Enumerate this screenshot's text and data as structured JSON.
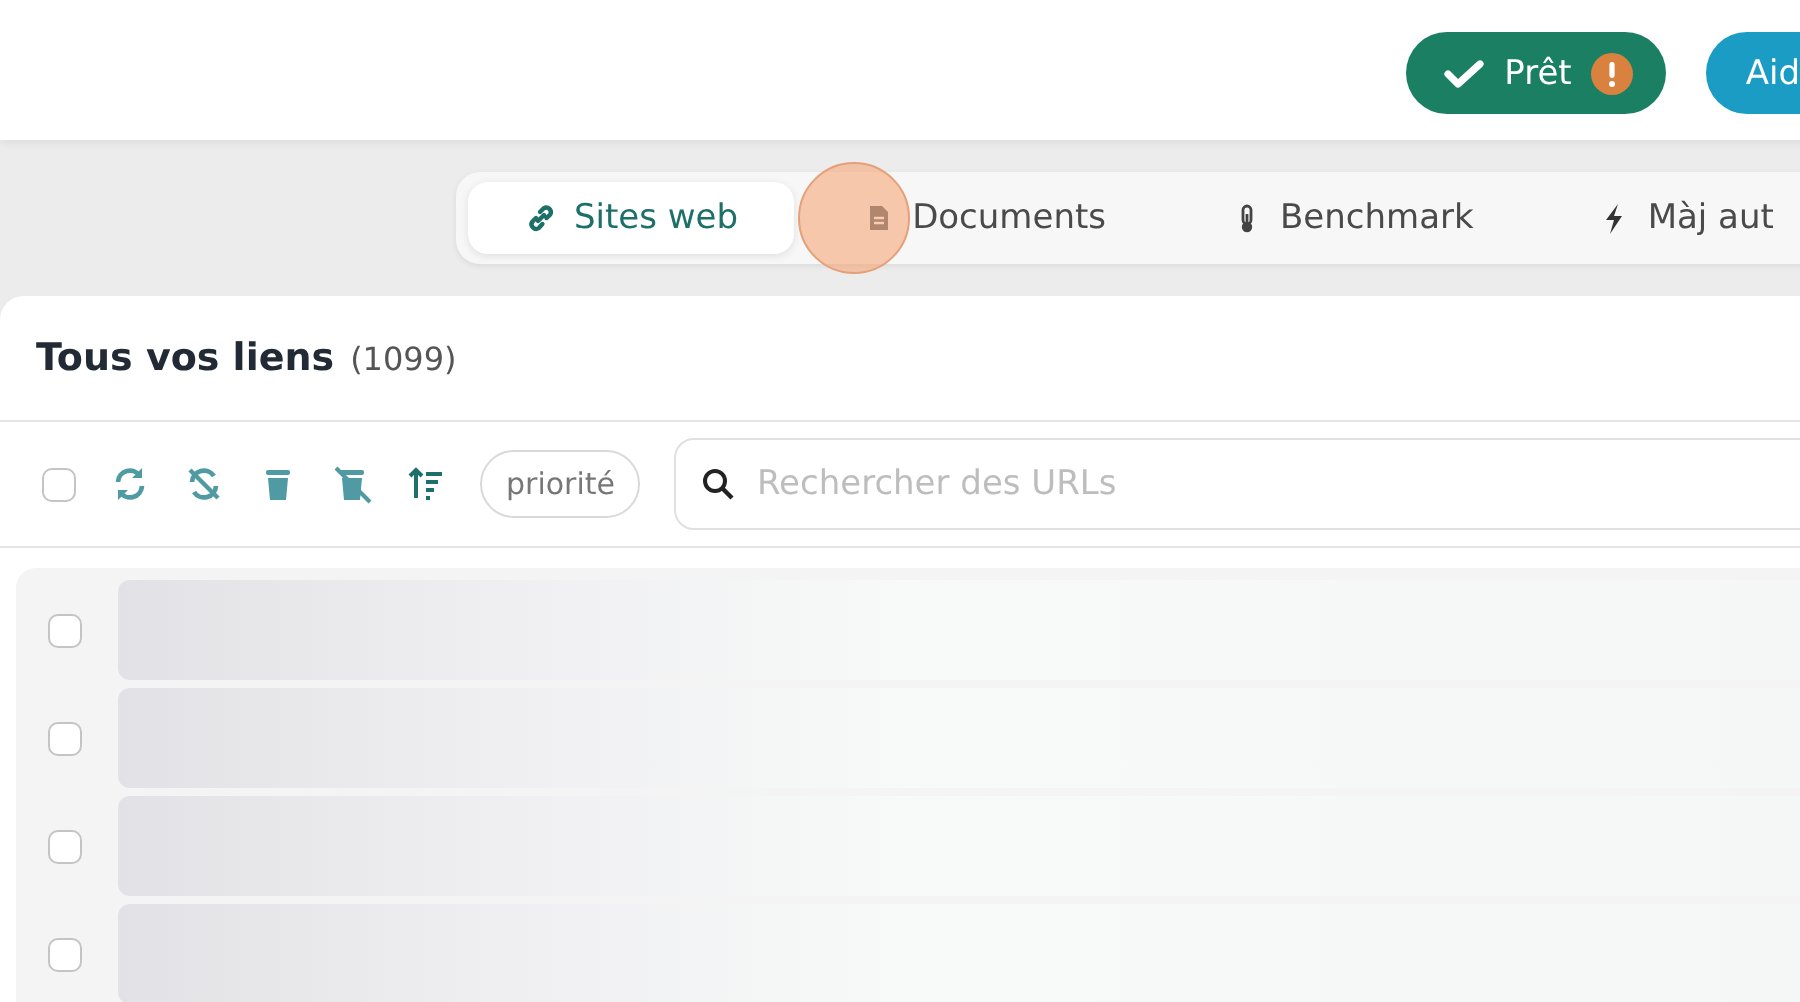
{
  "header": {
    "status": {
      "label": "Prêt",
      "warning": true
    },
    "help_button": "Aid"
  },
  "tabs": [
    {
      "label": "Sites web",
      "selected": true,
      "clicked": false
    },
    {
      "label": "Documents",
      "selected": false,
      "clicked": true
    },
    {
      "label": "Benchmark",
      "selected": false,
      "clicked": false
    },
    {
      "label": "Màj aut",
      "selected": false,
      "clicked": false
    }
  ],
  "links": {
    "title": "Tous vos liens",
    "count": "(1099)",
    "toolbar": {
      "select_all": {
        "checked": false
      },
      "sort_chip": "priorité",
      "search": {
        "placeholder": "Rechercher des URLs"
      }
    },
    "rows": [
      {
        "checked": false
      },
      {
        "checked": false
      },
      {
        "checked": false
      },
      {
        "checked": false
      }
    ]
  }
}
